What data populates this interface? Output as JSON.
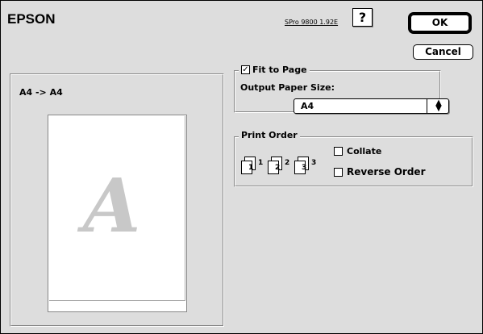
{
  "header": {
    "logo": "EPSON",
    "model": "SPro 9800 1.92E",
    "help_label": "?"
  },
  "buttons": {
    "ok_label": "OK",
    "cancel_label": "Cancel"
  },
  "preview": {
    "label": "A4 -> A4",
    "glyph": "A"
  },
  "fit": {
    "checkbox_label": "Fit to Page",
    "checked": true,
    "output_label": "Output Paper Size:",
    "paper_size": "A4"
  },
  "print_order": {
    "title": "Print Order",
    "page_numbers": [
      "1",
      "2",
      "3"
    ],
    "collate_label": "Collate",
    "collate_checked": false,
    "reverse_label": "Reverse Order",
    "reverse_checked": false
  }
}
